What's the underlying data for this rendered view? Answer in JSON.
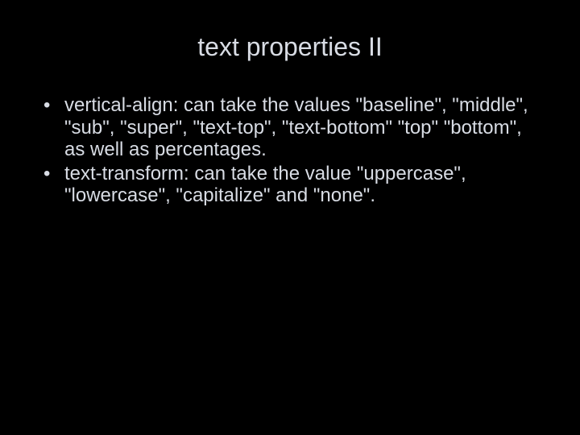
{
  "slide": {
    "title": "text properties II",
    "bullets": [
      "vertical-align: can take the values \"baseline\", \"middle\", \"sub\", \"super\", \"text-top\", \"text-bottom\" \"top\" \"bottom\", as well as percentages.",
      "text-transform: can take the value \"uppercase\", \"lowercase\", \"capitalize\" and \"none\"."
    ]
  }
}
